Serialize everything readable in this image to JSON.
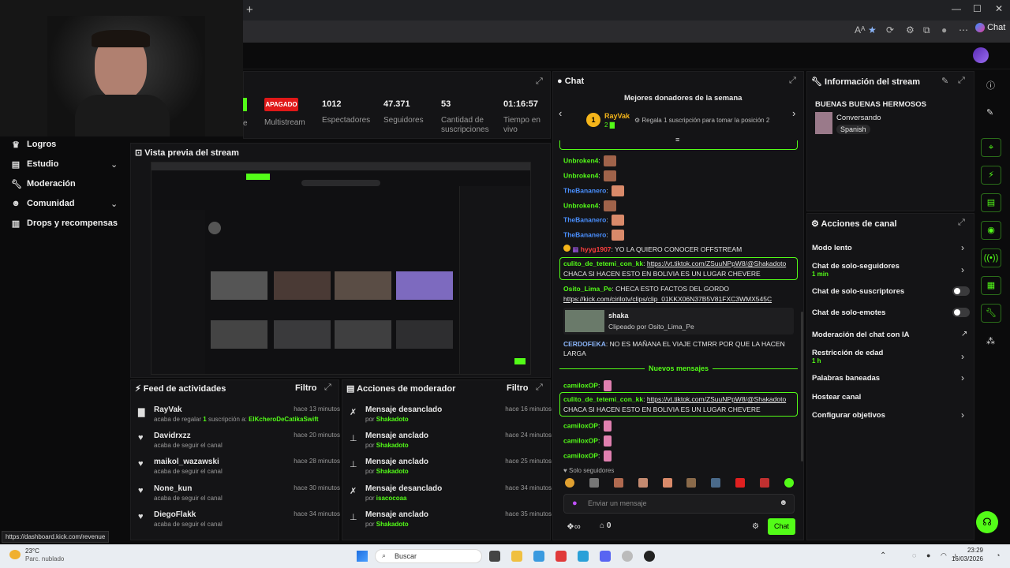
{
  "browser": {
    "new_tab": "+",
    "minimize": "—",
    "maximize": "☐",
    "close": "✕",
    "toolbar_icons": [
      "Aᴬ",
      "★",
      "⟳",
      "⚙",
      "⧉",
      "●",
      "⋯"
    ],
    "chat_label": "Chat"
  },
  "sidebar": {
    "items": [
      {
        "label": "Logros",
        "icon": "trophy-icon"
      },
      {
        "label": "Estudio",
        "icon": "studio-icon"
      },
      {
        "label": "Moderación",
        "icon": "wrench-icon"
      },
      {
        "label": "Comunidad",
        "icon": "community-icon"
      },
      {
        "label": "Drops y recompensas",
        "icon": "drops-icon"
      }
    ]
  },
  "stats": {
    "stream_tail": "e",
    "multistream_badge": "APAGADO",
    "multistream_label": "Multistream",
    "viewers_value": "1012",
    "viewers_label": "Espectadores",
    "followers_value": "47.371",
    "followers_label": "Seguidores",
    "subs_value": "53",
    "subs_label": "Cantidad de suscripciones",
    "time_value": "01:16:57",
    "time_label": "Tiempo en vivo"
  },
  "preview": {
    "title": "Vista previa del stream"
  },
  "feed": {
    "title": "Feed de actividades",
    "filter": "Filtro",
    "items": [
      {
        "name": "RayVak",
        "time": "hace 13 minutos",
        "sub_pre": "acaba de regalar ",
        "sub_num": "1",
        "sub_mid": " suscripción a: ",
        "sub_user": "ElKcheroDeCatikaSwift"
      },
      {
        "name": "Davidrxzz",
        "time": "hace 20 minutos",
        "sub": "acaba de seguir el canal"
      },
      {
        "name": "maikol_wazawski",
        "time": "hace 28 minutos",
        "sub": "acaba de seguir el canal"
      },
      {
        "name": "None_kun",
        "time": "hace 30 minutos",
        "sub": "acaba de seguir el canal"
      },
      {
        "name": "DiegoFlakk",
        "time": "hace 34 minutos",
        "sub": "acaba de seguir el canal"
      }
    ]
  },
  "mod_actions": {
    "title": "Acciones de moderador",
    "filter": "Filtro",
    "items": [
      {
        "action": "Mensaje desanclado",
        "time": "hace 16 minutos",
        "by": "por ",
        "user": "Shakadoto"
      },
      {
        "action": "Mensaje anclado",
        "time": "hace 24 minutos",
        "by": "por ",
        "user": "Shakadoto"
      },
      {
        "action": "Mensaje anclado",
        "time": "hace 25 minutos",
        "by": "por ",
        "user": "Shakadoto"
      },
      {
        "action": "Mensaje desanclado",
        "time": "hace 34 minutos",
        "by": "por ",
        "user": "isacocoaa"
      },
      {
        "action": "Mensaje anclado",
        "time": "hace 35 minutos",
        "by": "por ",
        "user": "Shakadoto"
      }
    ]
  },
  "chat": {
    "title": "Chat",
    "donors_title": "Mejores donadores de la semana",
    "donor_rank": "1",
    "donor_name": "RayVak",
    "donor_count": "2",
    "gift_text": "Regala 1 suscripción para tomar la posición 2",
    "messages": {
      "m1": "Unbroken4",
      "m2": "Unbroken4",
      "m3": "TheBananero",
      "m4": "Unbroken4",
      "m5": "TheBananero",
      "m6": "TheBananero",
      "m7_user": "hyyg1907",
      "m7_text": ": YO LA QUIERO CONOCER OFFSTREAM",
      "m8_user": "culito_de_tetemi_con_kk",
      "m8_link": "https://vt.tiktok.com/ZSuuNPpW8/@Shakadoto",
      "m8_text": "CHACA SI HACEN ESTO EN BOLIVIA ES UN LUGAR CHEVERE",
      "m9_user": "Osito_Lima_Pe",
      "m9_text": ": CHECA ESTO FACTOS DEL GORDO",
      "m9_link": "https://kick.com/cirilotv/clips/clip_01KKX06N37B5V81FXC3WMX545C",
      "clip_title": "shaka",
      "clip_by": "Clipeado por Osito_Lima_Pe",
      "m10_user": "CERDOFEKA",
      "m10_text": ": NO ES MAÑANA EL VIAJE CTMRR POR QUE LA HACEN",
      "m10_text2": "LARGA",
      "new_messages": "Nuevos mensajes",
      "m11": "camiloxOP",
      "m12_user": "culito_de_tetemi_con_kk",
      "m12_link": "https://vt.tiktok.com/ZSuuNPpW8/@Shakadoto",
      "m12_text": "CHACA SI HACEN ESTO EN BOLIVIA ES UN LUGAR CHEVERE",
      "m13": "camiloxOP",
      "m14": "camiloxOP",
      "m15": "camiloxOP"
    },
    "followers_only": "Solo seguidores",
    "input_placeholder": "Enviar un mensaje",
    "points": "0",
    "send_label": "Chat"
  },
  "stream_info": {
    "title": "Información del stream",
    "stream_title": "BUENAS BUENAS HERMOSOS",
    "category": "Conversando",
    "language": "Spanish"
  },
  "channel_actions": {
    "title": "Acciones de canal",
    "items": [
      {
        "label": "Modo lento",
        "control": "arrow"
      },
      {
        "label": "Chat de solo-seguidores",
        "sub": "1 min",
        "control": "arrow"
      },
      {
        "label": "Chat de solo-suscriptores",
        "control": "toggle"
      },
      {
        "label": "Chat de solo-emotes",
        "control": "toggle"
      },
      {
        "label": "Moderación del chat con IA",
        "control": "external"
      },
      {
        "label": "Restricción de edad",
        "sub": "1 h",
        "control": "arrow"
      },
      {
        "label": "Palabras baneadas",
        "control": "arrow"
      },
      {
        "label": "Hostear canal",
        "control": "none"
      },
      {
        "label": "Configurar objetivos",
        "control": "arrow"
      }
    ]
  },
  "status_url": "https://dashboard.kick.com/revenue",
  "taskbar": {
    "weather_temp": "23°C",
    "weather_desc": "Parc. nublado",
    "search_placeholder": "Buscar",
    "time": "23:29",
    "date": "16/03/2026"
  },
  "colors": {
    "accent": "#53fc18",
    "bg": "#0b0b0c",
    "panel": "#141416"
  }
}
